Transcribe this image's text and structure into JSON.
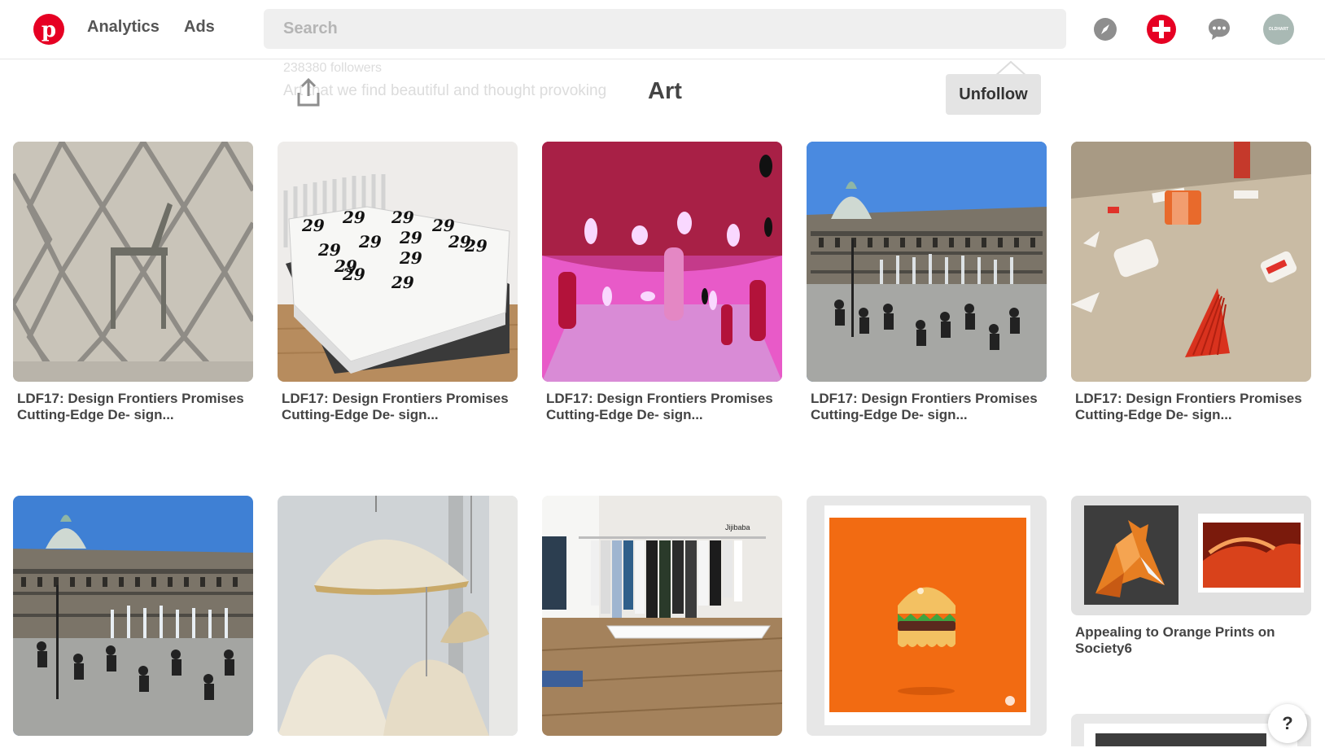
{
  "topbar": {
    "nav": [
      "Analytics",
      "Ads"
    ],
    "search_placeholder": "Search",
    "avatar_text": "OLDHART",
    "icons": [
      "pinterest-logo",
      "compass-icon",
      "add-icon",
      "chat-icon",
      "avatar"
    ],
    "brand_color": "#e60023"
  },
  "board": {
    "followers": "238380 followers",
    "description": "Art that we find beautiful and thought provoking",
    "title": "Art",
    "unfollow_label": "Unfollow"
  },
  "pins": [
    {
      "title": "LDF17: Design Frontiers Promises Cutting-Edge De- sign..."
    },
    {
      "title": "LDF17: Design Frontiers Promises Cutting-Edge De- sign..."
    },
    {
      "title": "LDF17: Design Frontiers Promises Cutting-Edge De- sign..."
    },
    {
      "title": "LDF17: Design Frontiers Promises Cutting-Edge De- sign..."
    },
    {
      "title": "LDF17: Design Frontiers Promises Cutting-Edge De- sign..."
    },
    {
      "title": ""
    },
    {
      "title": ""
    },
    {
      "title": ""
    },
    {
      "title": ""
    },
    {
      "title": "Appealing to Orange Prints on Society6"
    }
  ],
  "help_label": "?"
}
